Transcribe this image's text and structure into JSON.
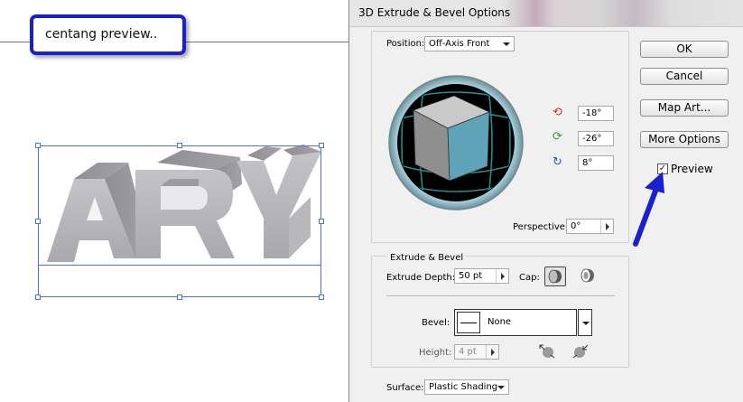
{
  "canvas": {
    "callout_text": "centang preview..",
    "artwork_text": "ARY"
  },
  "dialog": {
    "title": "3D Extrude & Bevel Options",
    "position": {
      "label": "Position:",
      "value": "Off-Axis Front"
    },
    "rotation": {
      "x_value": "-18°",
      "y_value": "-26°",
      "z_value": "8°"
    },
    "perspective": {
      "label": "Perspective:",
      "value": "0°"
    },
    "extrude_group": {
      "label": "Extrude & Bevel",
      "depth_label": "Extrude Depth:",
      "depth_value": "50 pt",
      "cap_label": "Cap:",
      "bevel_label": "Bevel:",
      "bevel_value": "None",
      "height_label": "Height:",
      "height_value": "4 pt"
    },
    "surface": {
      "label": "Surface:",
      "value": "Plastic Shading"
    },
    "buttons": {
      "ok": "OK",
      "cancel": "Cancel",
      "map_art": "Map Art...",
      "more_options": "More Options"
    },
    "preview": {
      "label": "Preview",
      "checked": true,
      "check_glyph": "✓"
    }
  },
  "colors": {
    "callout_border": "#1a1fd0",
    "arrow": "#1a1fd0",
    "selection": "#4a72d8",
    "cube_front": "#5ea3b8"
  }
}
